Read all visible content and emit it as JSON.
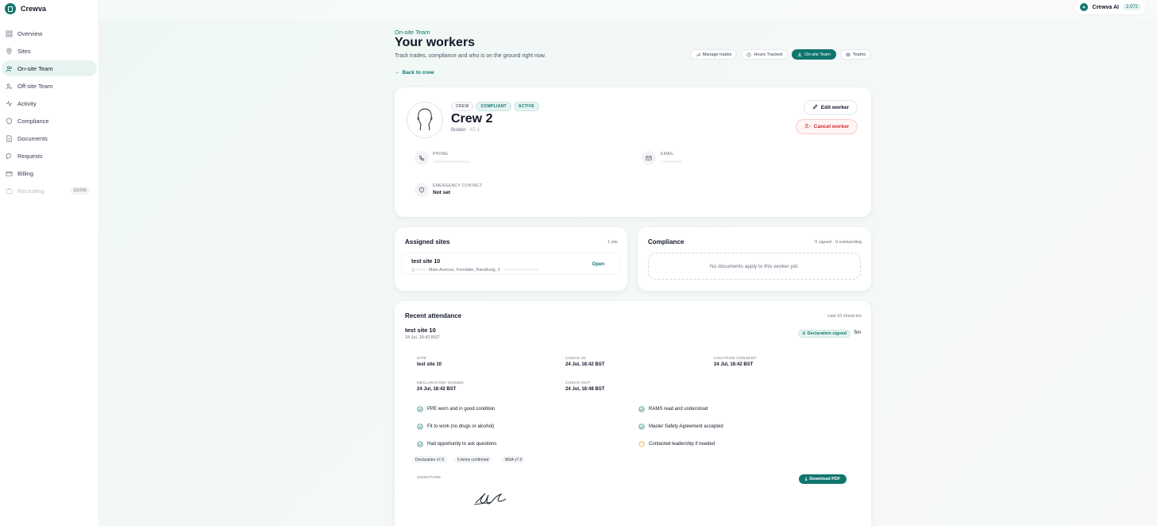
{
  "app": {
    "name": "Crewva"
  },
  "sidebar": {
    "items": [
      {
        "label": "Overview",
        "icon": "grid-icon"
      },
      {
        "label": "Sites",
        "icon": "map-pin-icon"
      },
      {
        "label": "On-site Team",
        "icon": "users-icon",
        "active": true
      },
      {
        "label": "Off-site Team",
        "icon": "user-remote-icon"
      },
      {
        "label": "Activity",
        "icon": "activity-icon"
      },
      {
        "label": "Compliance",
        "icon": "shield-icon"
      },
      {
        "label": "Documents",
        "icon": "document-icon"
      },
      {
        "label": "Requests",
        "icon": "chat-icon"
      },
      {
        "label": "Billing",
        "icon": "card-icon"
      },
      {
        "label": "Recruiting",
        "icon": "briefcase-icon",
        "disabled": true,
        "badge": "SOON"
      }
    ]
  },
  "ai": {
    "label": "Crewva AI",
    "count": "2,072"
  },
  "header": {
    "eyebrow": "On-site Team",
    "title": "Your workers",
    "subtitle": "Track trades, compliance and who is on the ground right now.",
    "back": "Back to crew"
  },
  "tabs": [
    {
      "label": "Manage trades",
      "icon": "wrench-icon"
    },
    {
      "label": "Hours Tracked",
      "icon": "clock-icon"
    },
    {
      "label": "On-site Team",
      "icon": "users-icon",
      "active": true
    },
    {
      "label": "Teams",
      "icon": "layers-icon"
    }
  ],
  "profile": {
    "badges": [
      "CREW",
      "COMPLIANT",
      "ACTIVE"
    ],
    "name": "Crew 2",
    "role": "Builder",
    "role_sep": "·",
    "code": "AT-1",
    "edit_label": "Edit worker",
    "cancel_label": "Cancel worker",
    "phone_label": "PHONE",
    "email_label": "EMAIL",
    "emergency_label": "EMERGENCY CONTACT",
    "emergency_value": "Not set"
  },
  "sites": {
    "title": "Assigned sites",
    "meta": "1 site",
    "items": [
      {
        "name": "test site 10",
        "address": "Main Avenue, Ferndale, Randburg, 2",
        "action": "Open"
      }
    ]
  },
  "compliance": {
    "title": "Compliance",
    "meta": "0 signed · 0 outstanding",
    "empty": "No documents apply to this worker yet."
  },
  "attendance": {
    "title": "Recent attendance",
    "meta": "Last 10 check-ins",
    "site": "test site 10",
    "date": "24 Jul, 18:42 BST",
    "badge": "Declaration signed",
    "duration": "5m",
    "fields": {
      "site_label": "SITE",
      "site_value": "test site 10",
      "checkin_label": "CHECK-IN",
      "checkin_value": "24 Jul, 18:42 BST",
      "consent_label": "LOCATION CONSENT",
      "consent_value": "24 Jul, 18:42 BST",
      "declared_label": "DECLARATION SIGNED",
      "declared_value": "24 Jul, 18:42 BST",
      "checkout_label": "CHECK-OUT",
      "checkout_value": "24 Jul, 18:48 BST"
    },
    "checks": [
      {
        "label": "PPE worn and in good condition",
        "status": "ok"
      },
      {
        "label": "RAMS read and understood",
        "status": "ok"
      },
      {
        "label": "Fit to work (no drugs or alcohol)",
        "status": "ok"
      },
      {
        "label": "Master Safety Agreement accepted",
        "status": "ok"
      },
      {
        "label": "Had opportunity to ask questions",
        "status": "ok"
      },
      {
        "label": "Contacted leadership if needed",
        "status": "warn"
      }
    ],
    "chips": [
      "Declaration v7.0",
      "6 items confirmed",
      "MSA v7.0"
    ],
    "signature_label": "SIGNATURE",
    "download_label": "Download PDF"
  },
  "colors": {
    "accent": "#0f766e",
    "danger": "#dc2626",
    "warn": "#f59e0b"
  }
}
